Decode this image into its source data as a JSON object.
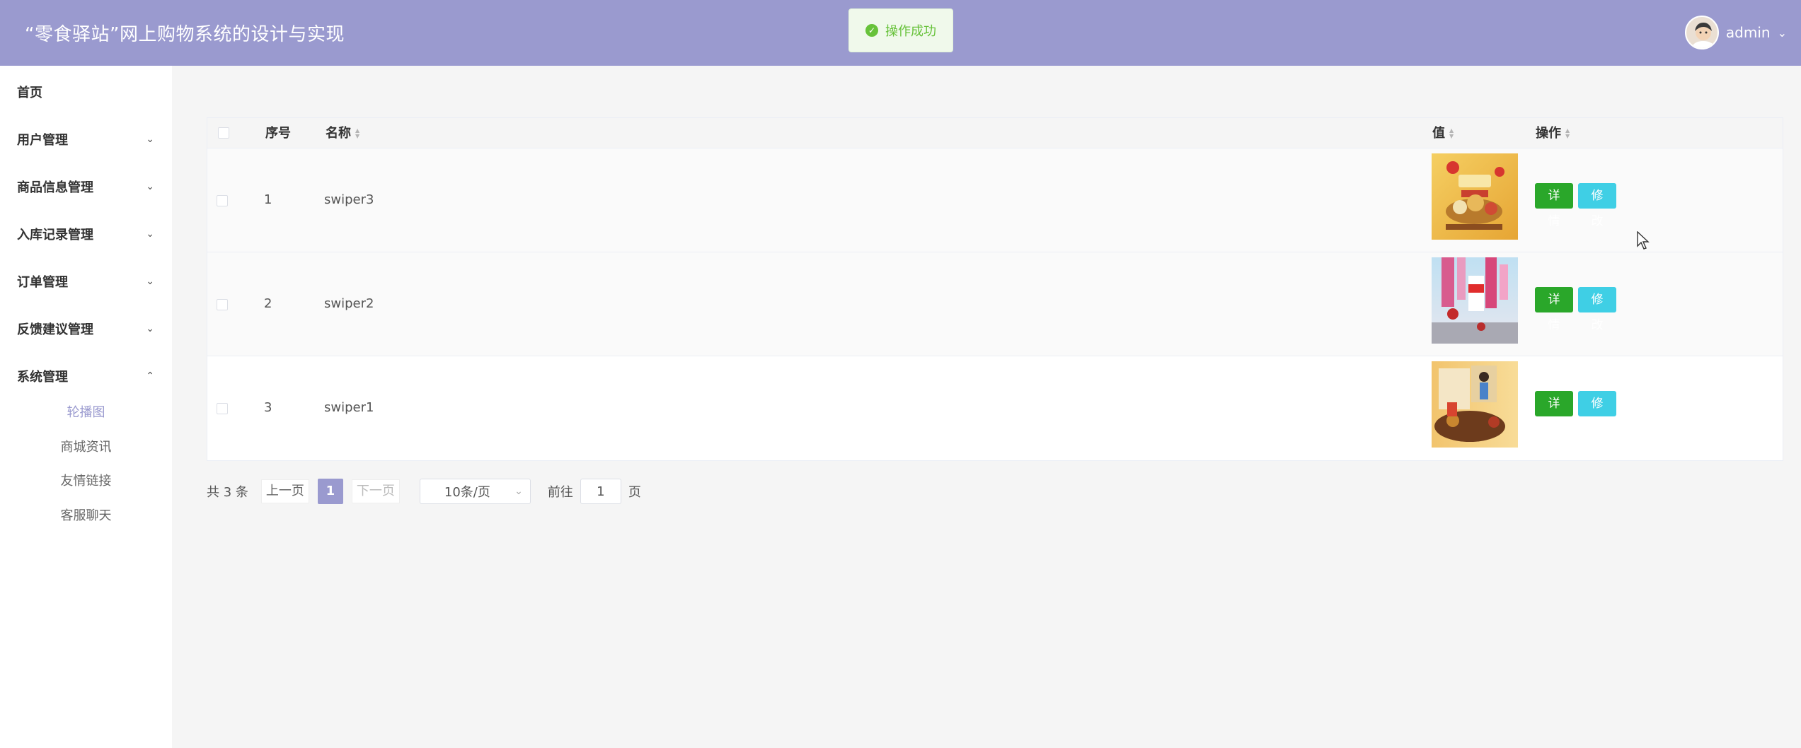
{
  "header": {
    "title": "“零食驿站”网上购物系统的设计与实现",
    "username": "admin",
    "avatar_icon": "user-avatar"
  },
  "toast": {
    "message": "操作成功",
    "icon": "success-check-icon",
    "color": "#67c23a"
  },
  "sidebar": {
    "items": [
      {
        "label": "首页",
        "expandable": false
      },
      {
        "label": "用户管理",
        "expandable": true,
        "expanded": false
      },
      {
        "label": "商品信息管理",
        "expandable": true,
        "expanded": false
      },
      {
        "label": "入库记录管理",
        "expandable": true,
        "expanded": false
      },
      {
        "label": "订单管理",
        "expandable": true,
        "expanded": false
      },
      {
        "label": "反馈建议管理",
        "expandable": true,
        "expanded": false
      },
      {
        "label": "系统管理",
        "expandable": true,
        "expanded": true
      }
    ],
    "submenu": [
      {
        "label": "轮播图",
        "active": true
      },
      {
        "label": "商城资讯",
        "active": false
      },
      {
        "label": "友情链接",
        "active": false
      },
      {
        "label": "客服聊天",
        "active": false
      }
    ]
  },
  "table": {
    "headers": {
      "index": "序号",
      "name": "名称",
      "value": "值",
      "actions": "操作"
    },
    "rows": [
      {
        "index": "1",
        "name": "swiper3",
        "image": "snack-banner-gold"
      },
      {
        "index": "2",
        "name": "swiper2",
        "image": "snack-banner-pink"
      },
      {
        "index": "3",
        "name": "swiper1",
        "image": "snack-banner-bag"
      }
    ],
    "detail_label": "详情",
    "edit_label": "修改"
  },
  "pagination": {
    "total_text": "共 3 条",
    "prev_label": "上一页",
    "current_page": "1",
    "next_label": "下一页",
    "page_size": "10条/页",
    "goto_label": "前往",
    "goto_value": "1",
    "page_suffix": "页"
  },
  "colors": {
    "primary": "#9a9acf",
    "detail_button": "#2aa72a",
    "edit_button": "#3fcfe5"
  }
}
